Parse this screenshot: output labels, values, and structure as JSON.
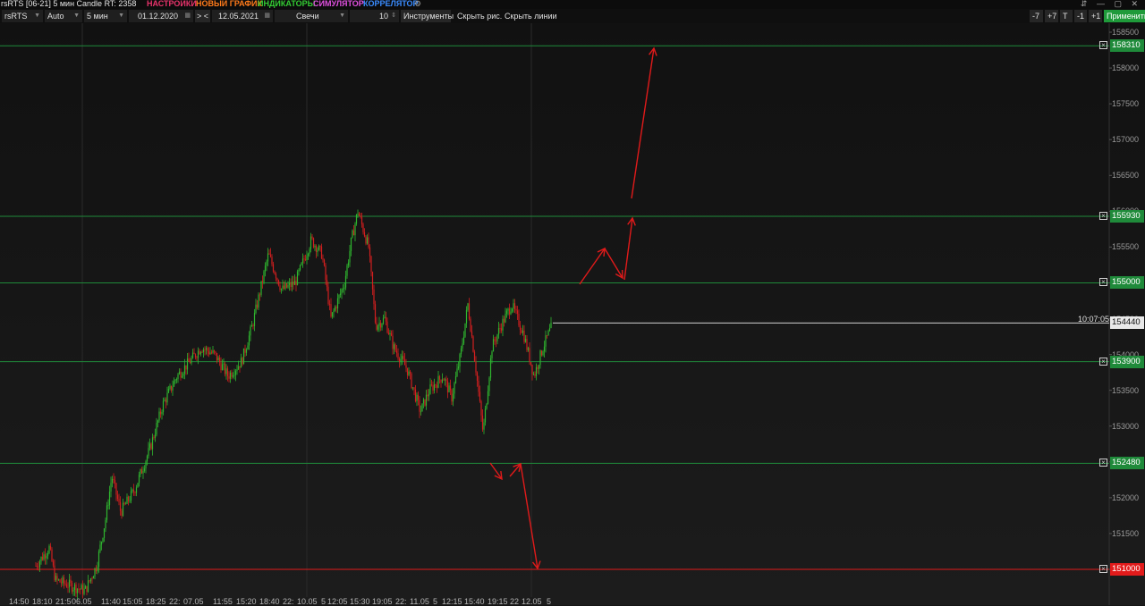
{
  "titlebar": {
    "title": "rsRTS [06-21] 5 мин Candle RT: 2358",
    "menu": [
      {
        "label": "НАСТРОЙКИ",
        "color": "#e8336b"
      },
      {
        "label": "НОВЫЙ ГРАФИК",
        "color": "#ff7a1a"
      },
      {
        "label": "ИНДИКАТОРЫ",
        "color": "#33cc33"
      },
      {
        "label": "СИМУЛЯТОР",
        "color": "#e050e0"
      },
      {
        "label": "КОРРЕЛЯТОР",
        "color": "#3a8cff"
      }
    ],
    "window_controls": "⇵ — ▢ ✕"
  },
  "toolbar": {
    "symbol": "rsRTS",
    "scale": "Auto",
    "timeframe": "5 мин",
    "date_from": "01.12.2020",
    "nav": "> <",
    "date_to": "12.05.2021",
    "chart_type": "Свечи",
    "count": "10",
    "tools": "Инструменты",
    "hide_drawings": "Скрыть рис.",
    "hide_lines": "Скрыть линии",
    "minus7": "-7",
    "plus7": "+7",
    "t": "T",
    "minus1": "-1",
    "plus1": "+1",
    "apply": "Применить"
  },
  "axis": {
    "labels": [
      "158500",
      "158000",
      "157500",
      "157000",
      "156500",
      "156000",
      "155500",
      "155000",
      "154500",
      "154000",
      "153500",
      "153000",
      "152500",
      "152000",
      "151500",
      "151000"
    ],
    "min": 150650,
    "max": 158850
  },
  "levels": [
    {
      "price": "158310",
      "color": "#1f8a3a"
    },
    {
      "price": "155930",
      "color": "#1f8a3a"
    },
    {
      "price": "155000",
      "color": "#1f8a3a"
    },
    {
      "price": "153900",
      "color": "#1f8a3a"
    },
    {
      "price": "152480",
      "color": "#1f8a3a"
    },
    {
      "price": "151000",
      "color": "#e21b1b"
    }
  ],
  "last_price": {
    "price": "154440",
    "time": "10:07:05"
  },
  "time_axis": [
    "14:50",
    "18:10",
    "21:5",
    "06.05",
    "11:40",
    "15:05",
    "18:25",
    "22:",
    "07.05",
    "11:55",
    "15:20",
    "18:40",
    "22:",
    "10.05",
    "5",
    "12:05",
    "15:30",
    "19:05",
    "22:",
    "11.05",
    "5",
    "12:15",
    "15:40",
    "19:15",
    "22",
    "12.05",
    "5"
  ],
  "colors": {
    "bull": "#2fb52f",
    "bear": "#d21f1f",
    "grid": "#2a2a2a",
    "arrows": "#e01a1a",
    "level_line": "#1f8a3a"
  }
}
